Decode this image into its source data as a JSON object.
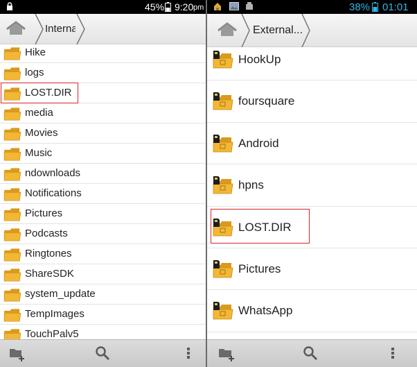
{
  "left": {
    "status": {
      "battery": "45%",
      "time": "9:20",
      "ampm": "pm"
    },
    "breadcrumb": "Interna",
    "folders": [
      "Hike",
      "logs",
      "LOST.DIR",
      "media",
      "Movies",
      "Music",
      "ndownloads",
      "Notifications",
      "Pictures",
      "Podcasts",
      "Ringtones",
      "ShareSDK",
      "system_update",
      "TempImages",
      "TouchPalv5"
    ]
  },
  "right": {
    "status": {
      "battery": "38%",
      "time": "01:01"
    },
    "breadcrumb": "External...",
    "folders": [
      "HookUp",
      "foursquare",
      "Android",
      "hpns",
      "LOST.DIR",
      "Pictures",
      "WhatsApp"
    ]
  },
  "colors": {
    "highlight": "#d9242b",
    "status_blue": "#33b5e5",
    "folder": "#f2b735"
  },
  "icons": [
    "lock-icon",
    "battery-icon",
    "home-icon",
    "folder-icon",
    "sd-card-icon",
    "new-folder-icon",
    "search-icon",
    "overflow-menu-icon"
  ]
}
